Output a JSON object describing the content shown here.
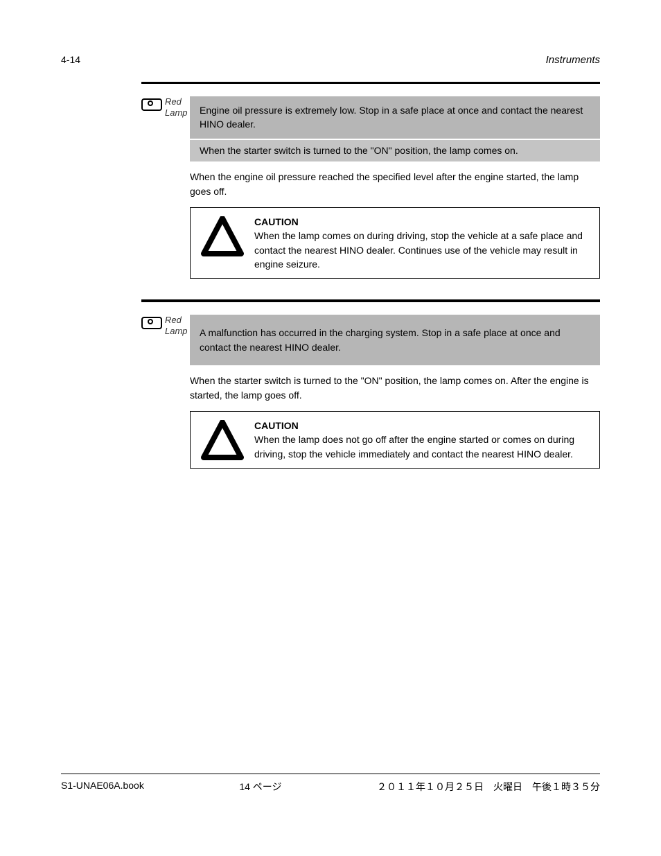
{
  "header": {
    "pageLeft": "4-14",
    "titleRight": "Instruments"
  },
  "section1": {
    "lampLabel": "Red Lamp",
    "shade1": "Engine oil pressure is extremely low. Stop in a safe place at once and contact the nearest HINO dealer.",
    "shade2": "When the starter switch is turned to the \"ON\" position, the lamp comes on.",
    "para": "When the engine oil pressure reached the specified level after the engine started, the lamp goes off.",
    "cautionTitle": "CAUTION",
    "cautionBody": "When the lamp comes on during driving, stop the vehicle at a safe place and contact the nearest HINO dealer. Continues use of the vehicle may result in engine seizure."
  },
  "section2": {
    "lampLabel": "Red Lamp",
    "shade1": "A malfunction has occurred in the charging system. Stop in a safe place at once and contact the nearest HINO dealer.",
    "para": "When the starter switch is turned to the \"ON\" position, the lamp comes on. After the engine is started, the lamp goes off.",
    "cautionTitle": "CAUTION",
    "cautionBody": "When the lamp does not go off after the engine started or comes on during driving, stop the vehicle immediately and contact the nearest HINO dealer."
  },
  "footer": {
    "left": "S1-UNAE06A.book",
    "center": "14 ページ",
    "right": "２０１１年１０月２５日　火曜日　午後１時３５分"
  }
}
